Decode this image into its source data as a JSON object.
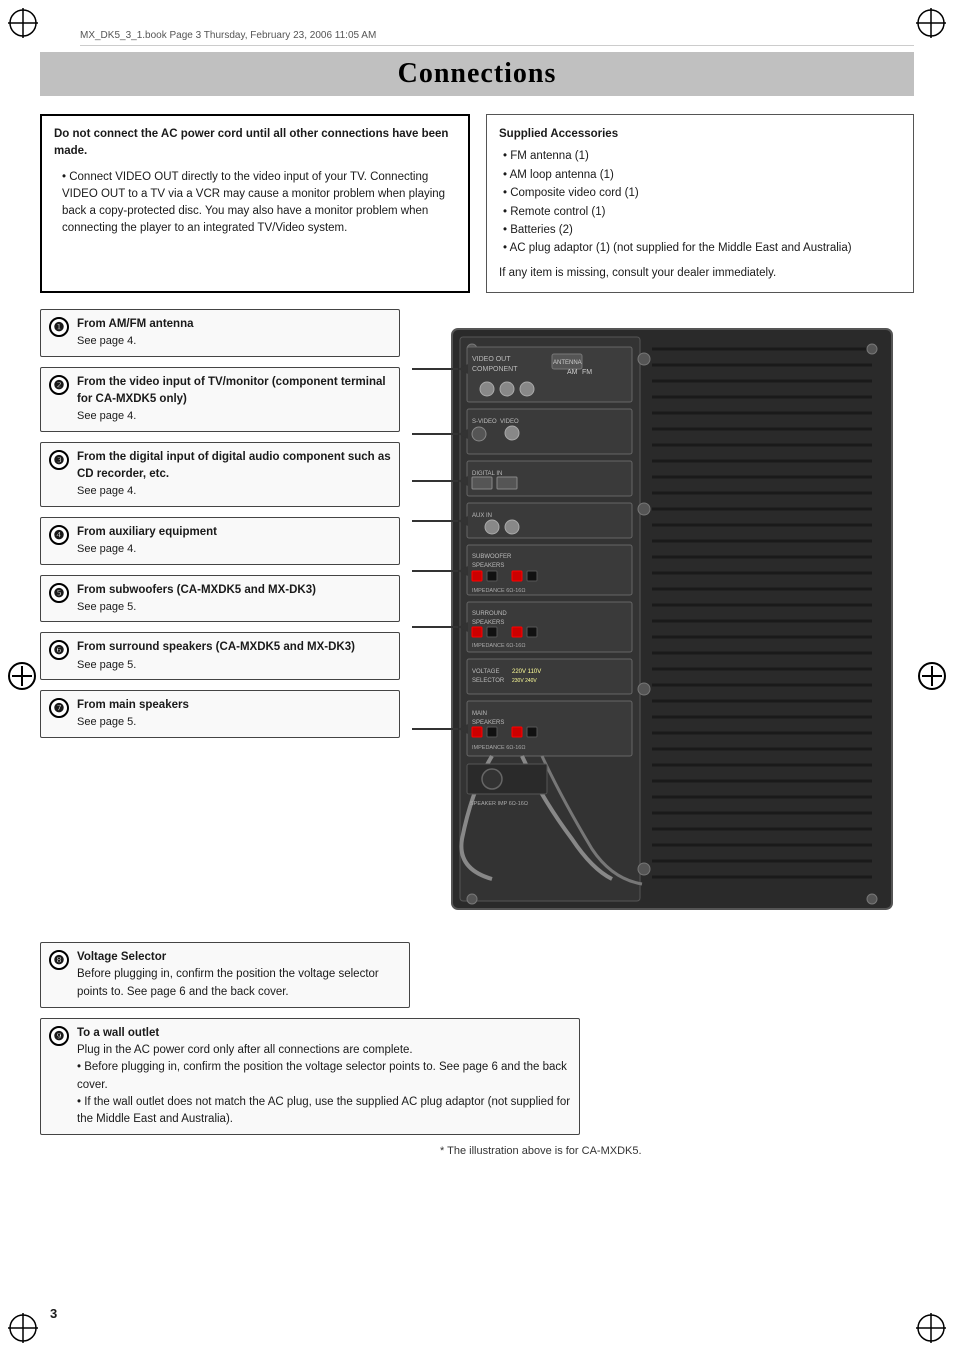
{
  "page": {
    "file_info": "MX_DK5_3_1.book  Page 3  Thursday, February 23, 2006  11:05 AM",
    "title": "Connections",
    "page_number": "3"
  },
  "warning_box": {
    "bold_text": "Do not connect the AC power cord until all other connections have been made.",
    "bullet": "Connect VIDEO OUT directly to the video input of your TV. Connecting VIDEO OUT to a TV via a VCR may cause a monitor problem when playing back a copy-protected disc. You may also have a monitor problem when connecting the player to an integrated TV/Video system."
  },
  "accessories_box": {
    "title": "Supplied Accessories",
    "items": [
      "FM antenna (1)",
      "AM loop antenna (1)",
      "Composite video cord (1)",
      "Remote control (1)",
      "Batteries (2)",
      "AC plug adaptor (1) (not supplied for the Middle East and Australia)"
    ],
    "footer": "If any item is missing, consult your dealer immediately."
  },
  "connections": [
    {
      "number": "1",
      "title": "From AM/FM antenna",
      "see_page": "See page 4."
    },
    {
      "number": "2",
      "title": "From the video input of TV/monitor (component terminal for CA-MXDK5 only)",
      "see_page": "See page 4."
    },
    {
      "number": "3",
      "title": "From the digital input of digital audio component such as CD recorder, etc.",
      "see_page": "See page 4."
    },
    {
      "number": "4",
      "title": "From auxiliary equipment",
      "see_page": "See page 4."
    },
    {
      "number": "5",
      "title": "From subwoofers (CA-MXDK5 and MX-DK3)",
      "see_page": "See page 5."
    },
    {
      "number": "6",
      "title": "From surround speakers (CA-MXDK5 and MX-DK3)",
      "see_page": "See page 5."
    },
    {
      "number": "7",
      "title": "From main speakers",
      "see_page": "See page 5."
    }
  ],
  "bottom_items": [
    {
      "number": "8",
      "title": "Voltage Selector",
      "description": "Before plugging in, confirm the position the voltage selector points to. See page 6 and the back cover."
    },
    {
      "number": "9",
      "title": "To a wall outlet",
      "bullets": [
        "Plug in the AC power cord only after all connections are complete.",
        "Before plugging in, confirm the position the voltage selector points to. See page 6 and the back cover.",
        "If the wall outlet does not match the AC plug, use the supplied AC plug adaptor (not supplied for the Middle East and Australia)."
      ]
    }
  ],
  "illustration_note": "* The illustration above is for CA-MXDK5."
}
